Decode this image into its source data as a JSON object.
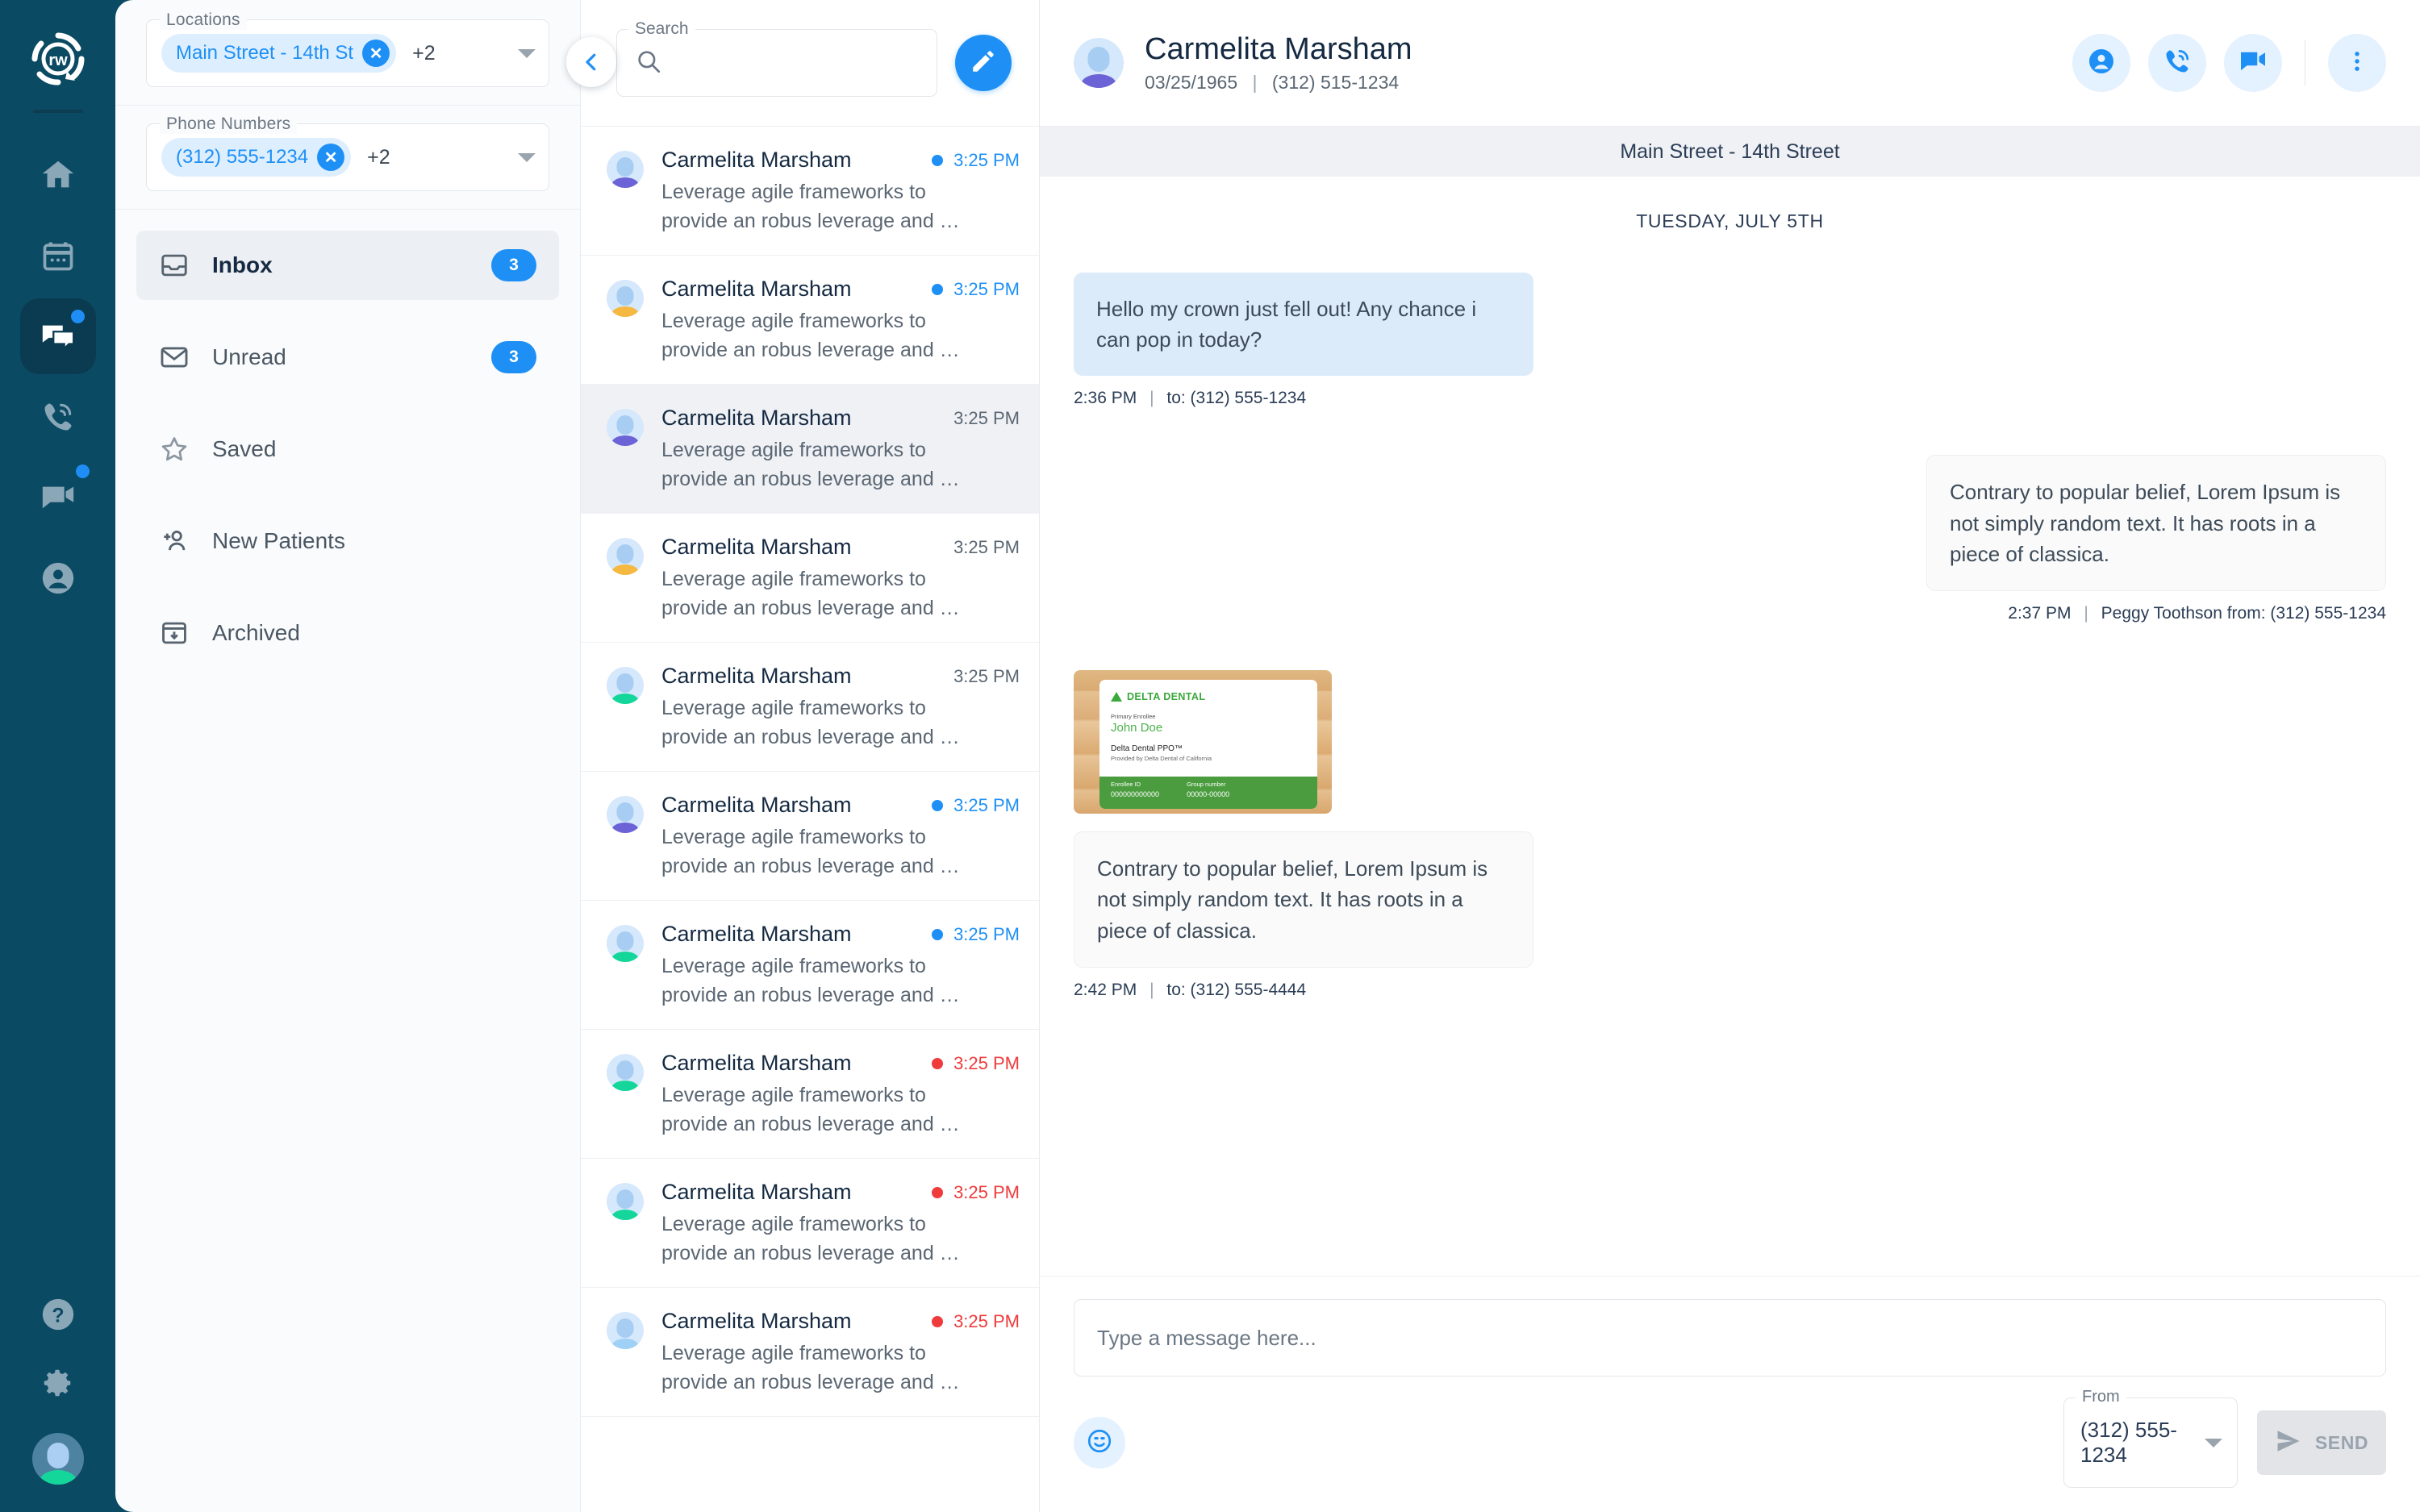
{
  "brand": {
    "logo_text": "rw",
    "accent": "#1e90f5",
    "rail_bg": "#0b4a63"
  },
  "rail": {
    "items": [
      {
        "name": "home",
        "icon": "home-icon",
        "badge": false,
        "active": false
      },
      {
        "name": "calendar",
        "icon": "calendar-icon",
        "badge": false,
        "active": false
      },
      {
        "name": "messages",
        "icon": "chat-bubbles-icon",
        "badge": true,
        "active": true
      },
      {
        "name": "calls",
        "icon": "phone-ring-icon",
        "badge": false,
        "active": false
      },
      {
        "name": "video",
        "icon": "video-chat-icon",
        "badge": true,
        "active": false
      },
      {
        "name": "contacts",
        "icon": "person-circle-icon",
        "badge": false,
        "active": false
      }
    ],
    "bottom": [
      {
        "name": "help",
        "icon": "help-circle-icon"
      },
      {
        "name": "settings",
        "icon": "gear-icon"
      },
      {
        "name": "user-avatar",
        "icon": "avatar"
      }
    ]
  },
  "filters": {
    "locations": {
      "legend": "Locations",
      "chip": "Main Street - 14th St",
      "more": "+2",
      "remove_icon": "close-icon",
      "caret_icon": "chevron-down-icon"
    },
    "phone_numbers": {
      "legend": "Phone Numbers",
      "chip": "(312) 555-1234",
      "more": "+2",
      "remove_icon": "close-icon",
      "caret_icon": "chevron-down-icon"
    }
  },
  "folders": [
    {
      "label": "Inbox",
      "icon": "inbox-icon",
      "badge": "3",
      "active": true
    },
    {
      "label": "Unread",
      "icon": "envelope-icon",
      "badge": "3",
      "active": false
    },
    {
      "label": "Saved",
      "icon": "star-icon",
      "badge": "",
      "active": false
    },
    {
      "label": "New Patients",
      "icon": "person-add-icon",
      "badge": "",
      "active": false
    },
    {
      "label": "Archived",
      "icon": "archive-icon",
      "badge": "",
      "active": false
    }
  ],
  "collapse_button": {
    "icon": "chevron-left-icon"
  },
  "search": {
    "legend": "Search",
    "value": "",
    "placeholder": "",
    "icon": "search-icon"
  },
  "compose_button": {
    "icon": "pencil-icon"
  },
  "conversations": [
    {
      "name": "Carmelita Marsham",
      "snippet": "Leverage agile frameworks to provide an robus leverage and …",
      "time": "3:25 PM",
      "unread": true,
      "status": "blue",
      "avatar_color": "#6b63d6",
      "selected": false
    },
    {
      "name": "Carmelita Marsham",
      "snippet": "Leverage agile frameworks to provide an robus leverage and …",
      "time": "3:25 PM",
      "unread": true,
      "status": "blue",
      "avatar_color": "#f5b942",
      "selected": false
    },
    {
      "name": "Carmelita Marsham",
      "snippet": "Leverage agile frameworks to provide an robus leverage and …",
      "time": "3:25 PM",
      "unread": false,
      "status": "none",
      "avatar_color": "#6b63d6",
      "selected": true
    },
    {
      "name": "Carmelita Marsham",
      "snippet": "Leverage agile frameworks to provide an robus leverage and …",
      "time": "3:25 PM",
      "unread": false,
      "status": "none",
      "avatar_color": "#f5b942",
      "selected": false
    },
    {
      "name": "Carmelita Marsham",
      "snippet": "Leverage agile frameworks to provide an robus leverage and …",
      "time": "3:25 PM",
      "unread": false,
      "status": "none",
      "avatar_color": "#14d69a",
      "selected": false
    },
    {
      "name": "Carmelita Marsham",
      "snippet": "Leverage agile frameworks to provide an robus leverage and …",
      "time": "3:25 PM",
      "unread": true,
      "status": "blue",
      "avatar_color": "#6b63d6",
      "selected": false
    },
    {
      "name": "Carmelita Marsham",
      "snippet": "Leverage agile frameworks to provide an robus leverage and …",
      "time": "3:25 PM",
      "unread": true,
      "status": "blue",
      "avatar_color": "#14d69a",
      "selected": false
    },
    {
      "name": "Carmelita Marsham",
      "snippet": "Leverage agile frameworks to provide an robus leverage and …",
      "time": "3:25 PM",
      "unread": true,
      "status": "red",
      "avatar_color": "#14d69a",
      "selected": false
    },
    {
      "name": "Carmelita Marsham",
      "snippet": "Leverage agile frameworks to provide an robus leverage and …",
      "time": "3:25 PM",
      "unread": true,
      "status": "red",
      "avatar_color": "#14d69a",
      "selected": false
    },
    {
      "name": "Carmelita Marsham",
      "snippet": "Leverage agile frameworks to provide an robus leverage and …",
      "time": "3:25 PM",
      "unread": true,
      "status": "red",
      "avatar_color": "#9fd0f5",
      "selected": false
    }
  ],
  "chat": {
    "contact_name": "Carmelita Marsham",
    "dob": "03/25/1965",
    "phone": "(312) 515-1234",
    "separator": "|",
    "avatar_color": "#6b63d6",
    "actions": [
      {
        "name": "patient-profile",
        "icon": "person-circle-icon"
      },
      {
        "name": "call",
        "icon": "phone-ring-icon"
      },
      {
        "name": "video-call",
        "icon": "video-chat-icon"
      },
      {
        "name": "more-options",
        "icon": "more-vertical-icon"
      }
    ],
    "location_bar": "Main Street - 14th Street",
    "date_separator": "TUESDAY, JULY 5TH",
    "messages": [
      {
        "direction": "in",
        "text": "Hello my crown just fell out! Any chance i can pop in today?",
        "time": "2:36 PM",
        "meta": "to: (312) 555-1234",
        "type": "text"
      },
      {
        "direction": "out",
        "text": "Contrary to popular belief, Lorem Ipsum is not simply random text. It has roots in a piece of classica.",
        "time": "2:37 PM",
        "meta": "Peggy Toothson from:  (312) 555-1234",
        "type": "text"
      },
      {
        "direction": "in",
        "type": "image",
        "image": {
          "alt": "dental-insurance-card",
          "brand": "DELTA DENTAL",
          "enrollee_label": "Primary Enrollee",
          "enrollee_name": "John Doe",
          "plan": "Delta Dental PPO™",
          "provider": "Provided by Delta Dental of California",
          "id_label": "Enrollee ID",
          "id_value": "000000000000",
          "group_label": "Group number",
          "group_value": "00000-00000"
        }
      },
      {
        "direction": "in",
        "text": "Contrary to popular belief, Lorem Ipsum is not simply random text. It has roots in a piece of classica.",
        "time": "2:42 PM",
        "meta": "to:  (312) 555-4444",
        "type": "text"
      }
    ]
  },
  "composer": {
    "placeholder": "Type a message here...",
    "value": "",
    "emoji_icon": "emoji-smiley-icon",
    "from_legend": "From",
    "from_value": "(312) 555-1234",
    "from_caret": "chevron-down-icon",
    "send_label": "SEND",
    "send_icon": "send-icon"
  }
}
